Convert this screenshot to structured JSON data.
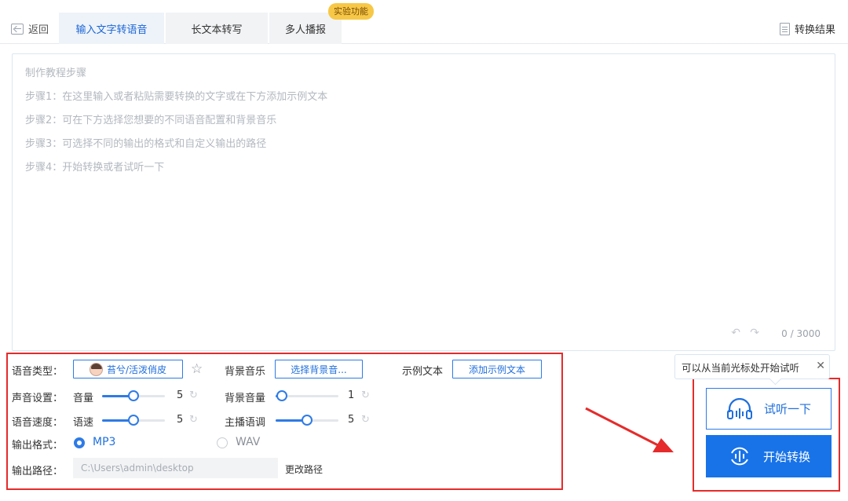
{
  "header": {
    "back_label": "返回",
    "tabs": [
      {
        "label": "输入文字转语音",
        "active": true
      },
      {
        "label": "长文本转写",
        "active": false
      },
      {
        "label": "多人播报",
        "active": false
      }
    ],
    "experimental_badge": "实验功能",
    "result_label": "转换结果"
  },
  "editor": {
    "placeholder_lines": [
      "制作教程步骤",
      "步骤1：在这里输入或者粘贴需要转换的文字或在下方添加示例文本",
      "步骤2：可在下方选择您想要的不同语音配置和背景音乐",
      "步骤3：可选择不同的输出的格式和自定义输出的路径",
      "步骤4：开始转换或者试听一下"
    ],
    "char_count": "0 / 3000"
  },
  "settings": {
    "voice_type_label": "语音类型：",
    "voice_name": "苔兮/活泼俏皮",
    "bg_music_label": "背景音乐",
    "bg_music_button": "选择背景音...",
    "sample_text_label": "示例文本",
    "sample_text_button": "添加示例文本",
    "sound_settings_label": "声音设置：",
    "volume_label": "音量",
    "volume_value": "5",
    "volume_fraction": 0.5,
    "bg_volume_label": "背景音量",
    "bg_volume_value": "1",
    "bg_volume_fraction": 0.1,
    "speed_section_label": "语音速度：",
    "speed_label": "语速",
    "speed_value": "5",
    "speed_fraction": 0.5,
    "pitch_label": "主播语调",
    "pitch_value": "5",
    "pitch_fraction": 0.5,
    "format_label": "输出格式：",
    "format_options": [
      "MP3",
      "WAV"
    ],
    "format_selected": "MP3",
    "output_path_label": "输出路径：",
    "output_path_value": "C:\\Users\\admin\\desktop",
    "change_path_label": "更改路径"
  },
  "actions": {
    "tooltip": "可以从当前光标处开始试听",
    "listen_button": "试听一下",
    "start_button": "开始转换"
  },
  "colors": {
    "accent": "#1873e8",
    "highlight_box": "#e52b2b",
    "badge": "#f7c847"
  }
}
